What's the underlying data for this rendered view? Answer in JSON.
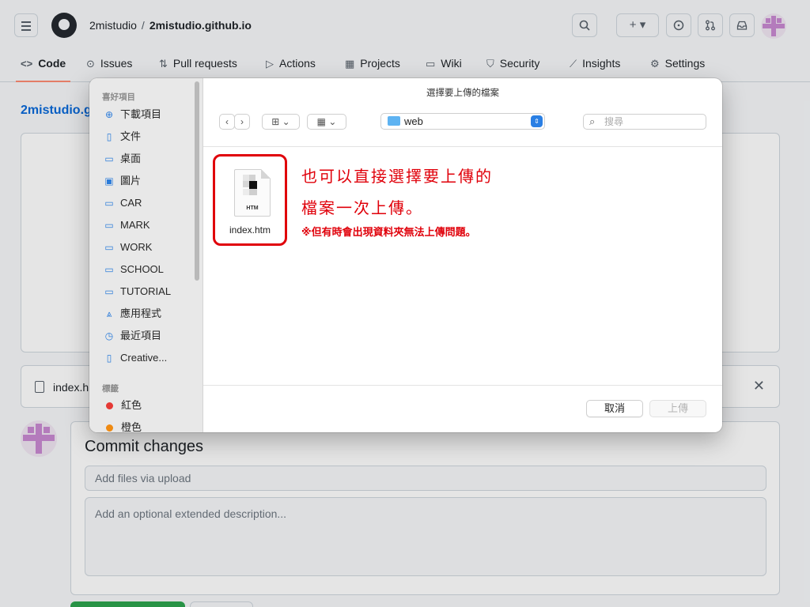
{
  "github": {
    "owner": "2mistudio",
    "repo": "2mistudio.github.io",
    "repo_link": "2mistudio.g",
    "tabs": [
      {
        "label": "Code",
        "icon": "code-icon"
      },
      {
        "label": "Issues",
        "icon": "issue-icon"
      },
      {
        "label": "Pull requests",
        "icon": "pull-request-icon"
      },
      {
        "label": "Actions",
        "icon": "play-icon"
      },
      {
        "label": "Projects",
        "icon": "table-icon"
      },
      {
        "label": "Wiki",
        "icon": "book-icon"
      },
      {
        "label": "Security",
        "icon": "shield-icon"
      },
      {
        "label": "Insights",
        "icon": "graph-icon"
      },
      {
        "label": "Settings",
        "icon": "gear-icon"
      }
    ],
    "uploaded_file": "index.h",
    "commit": {
      "title": "Commit changes",
      "summary_placeholder": "Add files via upload",
      "description_placeholder": "Add an optional extended description..."
    },
    "header_buttons": {
      "plus": "+ ▾"
    }
  },
  "dialog": {
    "title": "選擇要上傳的檔案",
    "favorites_label": "喜好項目",
    "tags_label": "標籤",
    "favorites": [
      {
        "label": "下載項目",
        "icon": "download-icon"
      },
      {
        "label": "文件",
        "icon": "document-icon"
      },
      {
        "label": "桌面",
        "icon": "desktop-icon"
      },
      {
        "label": "圖片",
        "icon": "photo-icon"
      },
      {
        "label": "CAR",
        "icon": "folder-icon"
      },
      {
        "label": "MARK",
        "icon": "folder-icon"
      },
      {
        "label": "WORK",
        "icon": "folder-icon"
      },
      {
        "label": "SCHOOL",
        "icon": "folder-icon"
      },
      {
        "label": "TUTORIAL",
        "icon": "folder-icon"
      },
      {
        "label": "應用程式",
        "icon": "applications-icon"
      },
      {
        "label": "最近項目",
        "icon": "clock-icon"
      },
      {
        "label": "Creative...",
        "icon": "document-icon"
      }
    ],
    "tags": [
      {
        "label": "紅色",
        "color": "#e53935"
      },
      {
        "label": "橙色",
        "color": "#ef8a12"
      }
    ],
    "location": "web",
    "search_placeholder": "搜尋",
    "file": {
      "name": "index.htm",
      "ext": "HTM"
    },
    "cancel_label": "取消",
    "upload_label": "上傳"
  },
  "annotation": {
    "line1": "也可以直接選擇要上傳的",
    "line2": "檔案一次上傳。",
    "note": "※但有時會出現資料夾無法上傳問題。",
    "color": "#e0000a"
  }
}
